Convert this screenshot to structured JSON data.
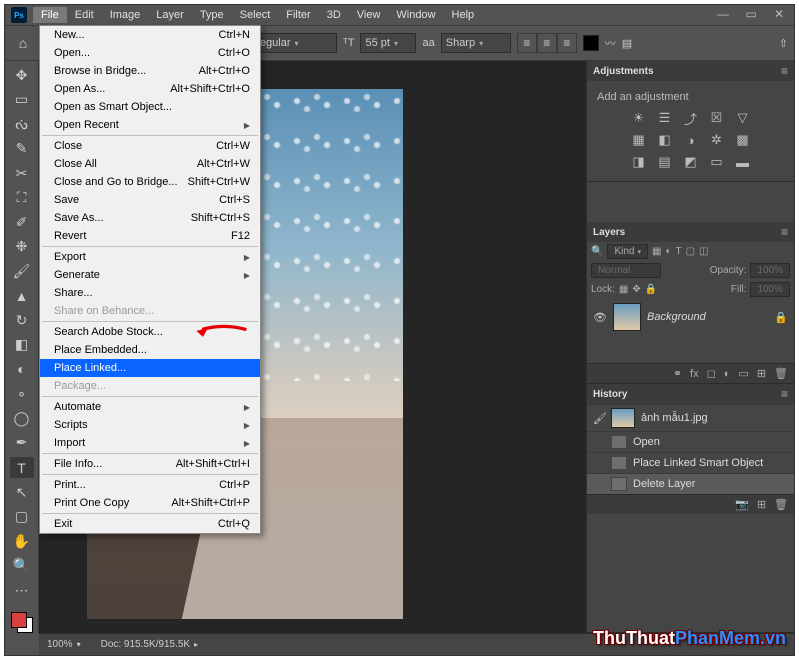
{
  "menubar": {
    "items": [
      "File",
      "Edit",
      "Image",
      "Layer",
      "Type",
      "Select",
      "Filter",
      "3D",
      "View",
      "Window",
      "Help"
    ],
    "active_index": 0
  },
  "options_bar": {
    "tool_preset_label": "T",
    "font_style": "Regular",
    "font_size": "55 pt",
    "aa_label": "aa",
    "antialias": "Sharp"
  },
  "file_menu": [
    {
      "label": "New...",
      "shortcut": "Ctrl+N"
    },
    {
      "label": "Open...",
      "shortcut": "Ctrl+O"
    },
    {
      "label": "Browse in Bridge...",
      "shortcut": "Alt+Ctrl+O"
    },
    {
      "label": "Open As...",
      "shortcut": "Alt+Shift+Ctrl+O"
    },
    {
      "label": "Open as Smart Object..."
    },
    {
      "label": "Open Recent",
      "submenu": true
    },
    {
      "sep": true
    },
    {
      "label": "Close",
      "shortcut": "Ctrl+W"
    },
    {
      "label": "Close All",
      "shortcut": "Alt+Ctrl+W"
    },
    {
      "label": "Close and Go to Bridge...",
      "shortcut": "Shift+Ctrl+W"
    },
    {
      "label": "Save",
      "shortcut": "Ctrl+S"
    },
    {
      "label": "Save As...",
      "shortcut": "Shift+Ctrl+S"
    },
    {
      "label": "Revert",
      "shortcut": "F12"
    },
    {
      "sep": true
    },
    {
      "label": "Export",
      "submenu": true
    },
    {
      "label": "Generate",
      "submenu": true
    },
    {
      "label": "Share..."
    },
    {
      "label": "Share on Behance...",
      "disabled": true
    },
    {
      "sep": true
    },
    {
      "label": "Search Adobe Stock..."
    },
    {
      "label": "Place Embedded..."
    },
    {
      "label": "Place Linked...",
      "highlight": true
    },
    {
      "label": "Package...",
      "disabled": true
    },
    {
      "sep": true
    },
    {
      "label": "Automate",
      "submenu": true
    },
    {
      "label": "Scripts",
      "submenu": true
    },
    {
      "label": "Import",
      "submenu": true
    },
    {
      "sep": true
    },
    {
      "label": "File Info...",
      "shortcut": "Alt+Shift+Ctrl+I"
    },
    {
      "sep": true
    },
    {
      "label": "Print...",
      "shortcut": "Ctrl+P"
    },
    {
      "label": "Print One Copy",
      "shortcut": "Alt+Shift+Ctrl+P"
    },
    {
      "sep": true
    },
    {
      "label": "Exit",
      "shortcut": "Ctrl+Q"
    }
  ],
  "adjustments": {
    "title": "Adjustments",
    "subtitle": "Add an adjustment"
  },
  "layers_panel": {
    "title": "Layers",
    "filter_label": "Kind",
    "blend_mode": "Normal",
    "opacity_label": "Opacity:",
    "opacity_value": "100%",
    "lock_label": "Lock:",
    "fill_label": "Fill:",
    "fill_value": "100%",
    "layer_name": "Background"
  },
  "history_panel": {
    "title": "History",
    "doc_name": "ảnh mẫu1.jpg",
    "steps": [
      "Open",
      "Place Linked Smart Object",
      "Delete Layer"
    ],
    "selected_index": 2
  },
  "status_bar": {
    "zoom": "100%",
    "doc_info": "Doc: 915.5K/915.5K"
  },
  "watermark": {
    "part1": "ThuThuat",
    "part2": "PhanMem",
    "part3": ".vn"
  }
}
